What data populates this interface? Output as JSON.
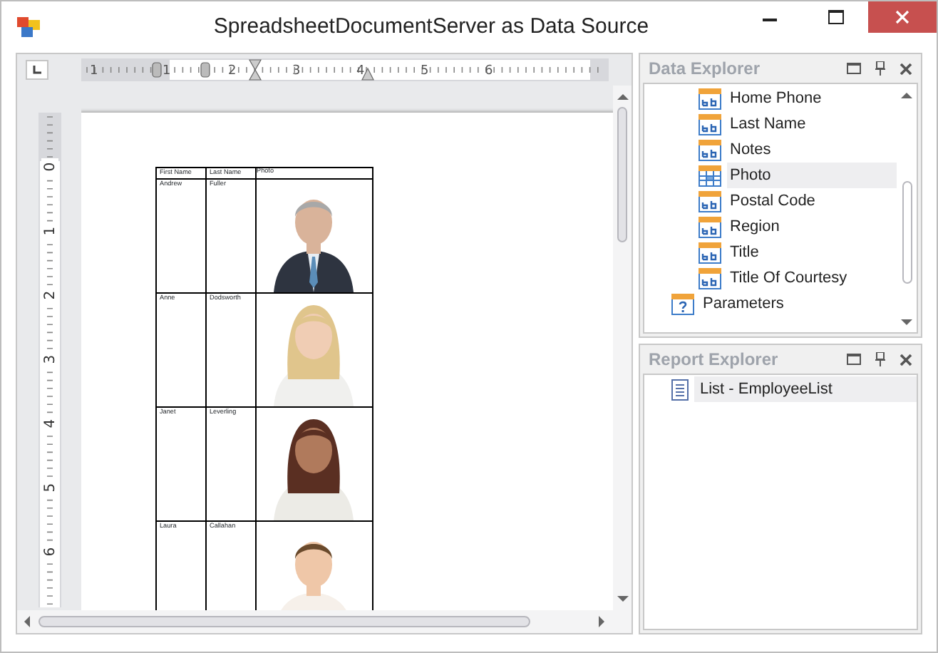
{
  "window": {
    "title": "SpreadsheetDocumentServer as Data Source"
  },
  "horizontal_ruler": {
    "labels": [
      "1",
      "1",
      "2",
      "3",
      "4",
      "5",
      "6"
    ]
  },
  "vertical_ruler": {
    "labels": [
      "0",
      "1",
      "2",
      "3",
      "4",
      "5",
      "6"
    ]
  },
  "report_table": {
    "columns": [
      "First Name",
      "Last Name",
      "Photo"
    ],
    "rows": [
      {
        "first_name": "Andrew",
        "last_name": "Fuller"
      },
      {
        "first_name": "Anne",
        "last_name": "Dodsworth"
      },
      {
        "first_name": "Janet",
        "last_name": "Leverling"
      },
      {
        "first_name": "Laura",
        "last_name": "Callahan"
      }
    ]
  },
  "data_explorer": {
    "title": "Data Explorer",
    "items": [
      {
        "label": "Home Phone",
        "kind": "text",
        "selected": false
      },
      {
        "label": "Last Name",
        "kind": "text",
        "selected": false
      },
      {
        "label": "Notes",
        "kind": "text",
        "selected": false
      },
      {
        "label": "Photo",
        "selected": true
      },
      {
        "label": "Postal Code",
        "kind": "text",
        "selected": false
      },
      {
        "label": "Region",
        "kind": "text",
        "selected": false
      },
      {
        "label": "Title",
        "kind": "text",
        "selected": false
      },
      {
        "label": "Title Of Courtesy",
        "kind": "text",
        "selected": false
      },
      {
        "label": "Parameters",
        "kind": "parameters",
        "selected": false
      }
    ]
  },
  "report_explorer": {
    "title": "Report Explorer",
    "items": [
      {
        "label": "List - EmployeeList",
        "selected": true
      }
    ]
  }
}
